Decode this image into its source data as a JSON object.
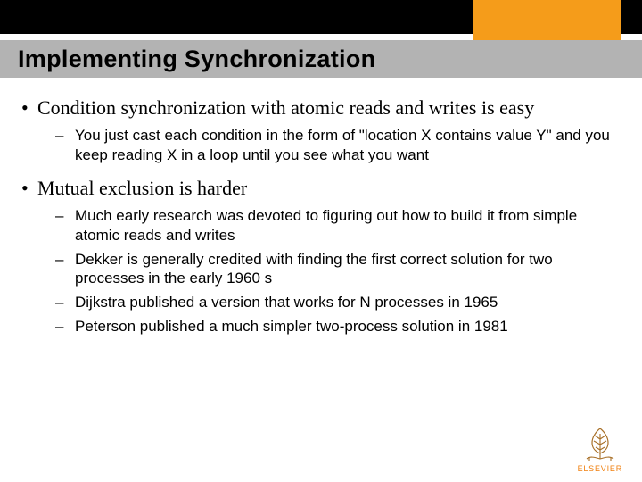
{
  "title": "Implementing Synchronization",
  "bullets": [
    {
      "text": "Condition synchronization with atomic reads and writes is easy",
      "sub": [
        "You just cast each condition in the form of \"location X contains value Y\" and you keep reading X in a loop until you see what you want"
      ]
    },
    {
      "text": "Mutual exclusion is harder",
      "sub": [
        "Much early research was devoted to figuring out how to build it from simple atomic reads and writes",
        "Dekker is generally credited with finding the first correct solution for two processes in the early 1960 s",
        "Dijkstra published a version that works for N processes in 1965",
        "Peterson published a much simpler two-process solution in 1981"
      ]
    }
  ],
  "logo_text": "ELSEVIER"
}
